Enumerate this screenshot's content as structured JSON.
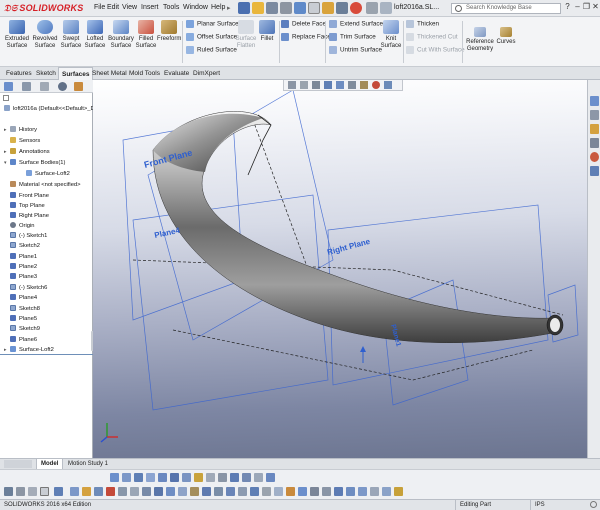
{
  "app": {
    "brand": "SOLIDWORKS",
    "document_title": "loft2016a.SL..."
  },
  "menu": [
    "File",
    "Edit",
    "View",
    "Insert",
    "Tools",
    "Window",
    "Help"
  ],
  "search": {
    "placeholder": "Search Knowledge Base"
  },
  "ribbon": {
    "big_buttons": [
      {
        "label1": "Extruded",
        "label2": "Surface"
      },
      {
        "label1": "Revolved",
        "label2": "Surface"
      },
      {
        "label1": "Swept",
        "label2": "Surface"
      },
      {
        "label1": "Lofted",
        "label2": "Surface"
      },
      {
        "label1": "Boundary",
        "label2": "Surface"
      },
      {
        "label1": "Filled",
        "label2": "Surface"
      },
      {
        "label1": "Freeform",
        "label2": ""
      }
    ],
    "col1": [
      "Planar Surface",
      "Offset Surface",
      "Ruled Surface"
    ],
    "surface_flatten": {
      "label1": "Surface",
      "label2": "Flatten"
    },
    "fillet": "Fillet",
    "col2": [
      "Delete Face",
      "Replace Face"
    ],
    "col3": [
      "Extend Surface",
      "Trim Surface",
      "Untrim Surface"
    ],
    "knit": {
      "label1": "Knit",
      "label2": "Surface"
    },
    "col4": [
      "Thicken",
      "Thickened Cut",
      "Cut With Surface"
    ],
    "reference_geometry": {
      "label1": "Reference",
      "label2": "Geometry"
    },
    "curves": "Curves"
  },
  "command_tabs": [
    "Features",
    "Sketch",
    "Surfaces",
    "Sheet Metal",
    "Mold Tools",
    "Evaluate",
    "DimXpert"
  ],
  "active_tab": "Surfaces",
  "feature_tree": {
    "root": "loft2016a (Default<<Default>_D",
    "items": [
      {
        "label": "History",
        "icon": "history-icon",
        "expand": "▸"
      },
      {
        "label": "Sensors",
        "icon": "sensors-icon",
        "expand": ""
      },
      {
        "label": "Annotations",
        "icon": "annotations-icon",
        "expand": "▸"
      },
      {
        "label": "Surface Bodies(1)",
        "icon": "surface-bodies-icon",
        "expand": "▾"
      },
      {
        "label": "Surface-Loft2",
        "icon": "surface-icon",
        "expand": ""
      },
      {
        "label": "Material <not specified>",
        "icon": "material-icon",
        "expand": ""
      },
      {
        "label": "Front Plane",
        "icon": "plane-icon",
        "expand": ""
      },
      {
        "label": "Top Plane",
        "icon": "plane-icon",
        "expand": ""
      },
      {
        "label": "Right Plane",
        "icon": "plane-icon",
        "expand": ""
      },
      {
        "label": "Origin",
        "icon": "origin-icon",
        "expand": ""
      },
      {
        "label": "(-) Sketch1",
        "icon": "sketch-icon",
        "expand": ""
      },
      {
        "label": "Sketch2",
        "icon": "sketch-icon",
        "expand": ""
      },
      {
        "label": "Plane1",
        "icon": "plane-icon",
        "expand": ""
      },
      {
        "label": "Plane2",
        "icon": "plane-icon",
        "expand": ""
      },
      {
        "label": "Plane3",
        "icon": "plane-icon",
        "expand": ""
      },
      {
        "label": "(-) Sketch6",
        "icon": "sketch-icon",
        "expand": ""
      },
      {
        "label": "Plane4",
        "icon": "plane-icon",
        "expand": ""
      },
      {
        "label": "Sketch8",
        "icon": "sketch-icon",
        "expand": ""
      },
      {
        "label": "Plane5",
        "icon": "plane-icon",
        "expand": ""
      },
      {
        "label": "Sketch9",
        "icon": "sketch-icon",
        "expand": ""
      },
      {
        "label": "Plane6",
        "icon": "plane-icon",
        "expand": ""
      },
      {
        "label": "Surface-Loft2",
        "icon": "loft-icon",
        "expand": "▸"
      }
    ]
  },
  "viewport_labels": {
    "front_plane": "Front Plane",
    "plane4": "Plane4",
    "right_plane": "Right Plane",
    "plane1": "Plane1"
  },
  "bottom_tabs": [
    "Model",
    "Motion Study 1"
  ],
  "active_bottom_tab": "Model",
  "status": {
    "left": "SOLIDWORKS 2016 x64 Edition",
    "mode": "Editing Part",
    "units": "IPS"
  },
  "colors": {
    "brand_red": "#d61f26",
    "plane_blue": "#2e5fcf",
    "selection_blue": "#6e8fb8"
  }
}
